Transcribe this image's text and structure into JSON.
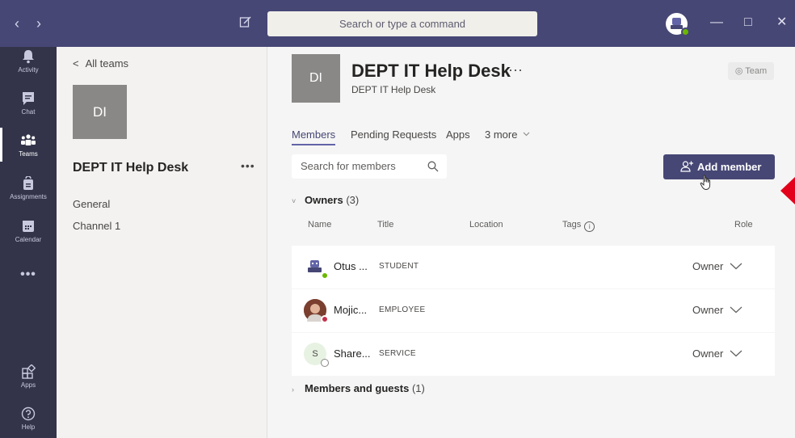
{
  "titlebar": {
    "back": "‹",
    "forward": "›",
    "search_placeholder": "Search or type a command",
    "minimize": "—",
    "maximize": "□",
    "close": "✕"
  },
  "rail": {
    "items": [
      {
        "label": "Activity"
      },
      {
        "label": "Chat"
      },
      {
        "label": "Teams"
      },
      {
        "label": "Assignments"
      },
      {
        "label": "Calendar"
      },
      {
        "label": "•••"
      },
      {
        "label": "Apps"
      },
      {
        "label": "Help"
      }
    ]
  },
  "left": {
    "back_label": "All teams",
    "team_initials": "DI",
    "team_name": "DEPT IT Help Desk",
    "more": "•••",
    "channels": [
      "General",
      "Channel 1"
    ]
  },
  "main": {
    "team_initials": "DI",
    "title": "DEPT IT Help Desk",
    "title_more": "···",
    "subtitle": "DEPT IT Help Desk",
    "badge": "Team",
    "tabs": [
      "Members",
      "Pending Requests",
      "Apps",
      "3 more"
    ],
    "search_placeholder": "Search for members",
    "add_member": "Add member",
    "owners": {
      "label": "Owners",
      "count": "(3)"
    },
    "columns": {
      "name": "Name",
      "title": "Title",
      "location": "Location",
      "tags": "Tags",
      "role": "Role"
    },
    "rows": [
      {
        "name": "Otus ...",
        "title": "STUDENT",
        "role": "Owner",
        "initial": ""
      },
      {
        "name": "Mojic...",
        "title": "EMPLOYEE",
        "role": "Owner",
        "initial": ""
      },
      {
        "name": "Share...",
        "title": "SERVICE",
        "role": "Owner",
        "initial": "S"
      }
    ],
    "members": {
      "label": "Members and guests",
      "count": "(1)"
    }
  },
  "colors": {
    "titlebar": "#464775",
    "rail": "#33344a",
    "accent": "#6264a7",
    "online": "#6bb700",
    "busy": "#c4314b",
    "marker": "#e3001b"
  }
}
